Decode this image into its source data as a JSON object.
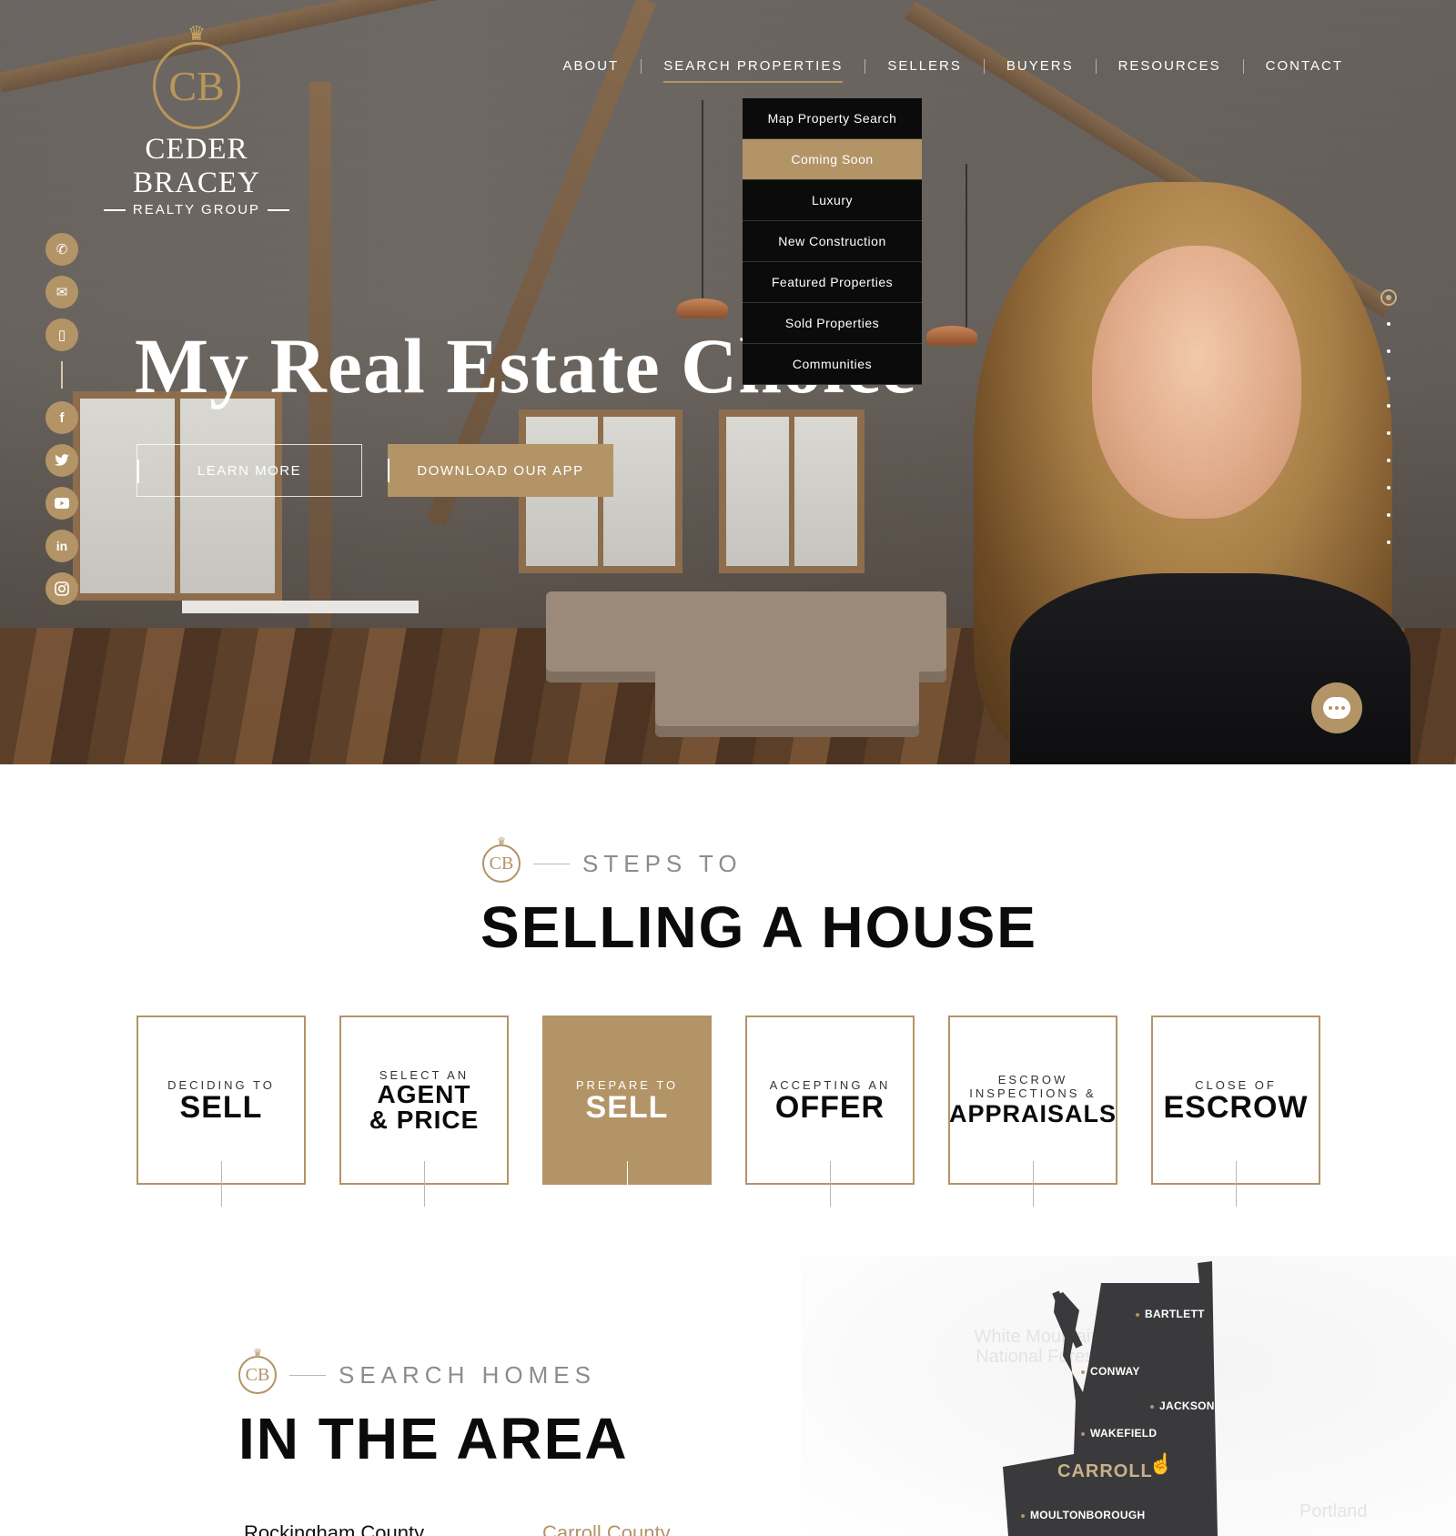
{
  "brand": {
    "monogram": "CB",
    "name": "CEDER BRACEY",
    "sub": "REALTY GROUP"
  },
  "nav": {
    "items": [
      "ABOUT",
      "SEARCH PROPERTIES",
      "SELLERS",
      "BUYERS",
      "RESOURCES",
      "CONTACT"
    ],
    "active": "SEARCH PROPERTIES"
  },
  "dropdown": {
    "items": [
      "Map Property Search",
      "Coming Soon",
      "Luxury",
      "New Construction",
      "Featured Properties",
      "Sold Properties",
      "Communities"
    ],
    "highlighted": "Coming Soon"
  },
  "social": {
    "contact_icons": [
      "phone-icon",
      "mail-icon",
      "mobile-app-icon"
    ],
    "network_icons": [
      "facebook-icon",
      "twitter-icon",
      "youtube-icon",
      "linkedin-icon",
      "instagram-icon"
    ]
  },
  "hero": {
    "headline": "My Real Estate Choice",
    "learn_more": "LEARN MORE",
    "download_app": "DOWNLOAD OUR APP",
    "slider_count": 10,
    "slider_active": 0
  },
  "steps_section": {
    "eyebrow": "STEPS TO",
    "title": "SELLING A HOUSE",
    "steps": [
      {
        "small": "DECIDING TO",
        "big": "SELL",
        "active": false
      },
      {
        "small": "SELECT AN",
        "big": "AGENT & PRICE",
        "active": false
      },
      {
        "small": "PREPARE TO",
        "big": "SELL",
        "active": true
      },
      {
        "small": "ACCEPTING AN",
        "big": "OFFER",
        "active": false
      },
      {
        "small": "ESCROW INSPECTIONS &",
        "big": "APPRAISALS",
        "active": false
      },
      {
        "small": "CLOSE OF",
        "big": "ESCROW",
        "active": false
      }
    ]
  },
  "search_section": {
    "eyebrow": "SEARCH HOMES",
    "title": "IN THE AREA",
    "counties": [
      "Rockingham County",
      "Carroll County"
    ]
  },
  "map": {
    "region_name": "CARROLL",
    "towns": [
      "BARTLETT",
      "CONWAY",
      "JACKSON",
      "WAKEFIELD",
      "MOULTONBOROUGH"
    ],
    "background_labels": [
      "White Mountain National Forest",
      "Portland"
    ]
  },
  "colors": {
    "accent": "#b39467",
    "dark": "#0b0b0b",
    "map_fill": "#3a3a3c"
  }
}
